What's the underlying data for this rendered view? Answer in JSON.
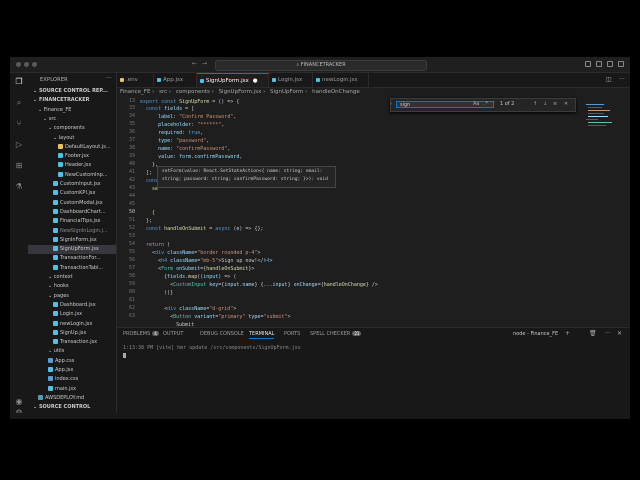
{
  "titlebar": {
    "search": "FINANCETRACKER"
  },
  "sidebar": {
    "title": "EXPLORER",
    "rows": [
      {
        "label": "SOURCE CONTROL REP...",
        "kind": "hdr",
        "indent": 1,
        "color": ""
      },
      {
        "label": "FINANCETRACKER",
        "kind": "hdr",
        "indent": 1,
        "color": ""
      },
      {
        "label": "Finance_FE",
        "kind": "folder",
        "indent": 2,
        "color": ""
      },
      {
        "label": "src",
        "kind": "folder",
        "indent": 3,
        "color": ""
      },
      {
        "label": "components",
        "kind": "folder",
        "indent": 4,
        "color": ""
      },
      {
        "label": "layout",
        "kind": "folder",
        "indent": 5,
        "color": ""
      },
      {
        "label": "DefaultLayout.js...",
        "kind": "file",
        "indent": 6,
        "color": "#e8c25b"
      },
      {
        "label": "Footer.jsx",
        "kind": "file",
        "indent": 6,
        "color": "#4fc1e9"
      },
      {
        "label": "Header.jsx",
        "kind": "file",
        "indent": 6,
        "color": "#4fc1e9"
      },
      {
        "label": "NewCustomInp...",
        "kind": "file",
        "indent": 6,
        "color": "#4fc1e9"
      },
      {
        "label": "CustomInput.jsx",
        "kind": "file",
        "indent": 5,
        "color": "#4fc1e9"
      },
      {
        "label": "CustomKPI.jsx",
        "kind": "file",
        "indent": 5,
        "color": "#4fc1e9"
      },
      {
        "label": "CustomModal.jsx",
        "kind": "file",
        "indent": 5,
        "color": "#4fc1e9"
      },
      {
        "label": "DashboardChart...",
        "kind": "file",
        "indent": 5,
        "color": "#4fc1e9"
      },
      {
        "label": "FinancialTips.jsx",
        "kind": "file",
        "indent": 5,
        "color": "#4fc1e9"
      },
      {
        "label": "NewSignInLogin.j...",
        "kind": "file",
        "indent": 5,
        "color": "#4fc1e9",
        "dim": true
      },
      {
        "label": "SignInForm.jsx",
        "kind": "file",
        "indent": 5,
        "color": "#4fc1e9"
      },
      {
        "label": "SignUpForm.jsx",
        "kind": "file",
        "indent": 5,
        "color": "#4fc1e9",
        "sel": true
      },
      {
        "label": "TransactionFor...",
        "kind": "file",
        "indent": 5,
        "color": "#4fc1e9"
      },
      {
        "label": "TransactionTabl...",
        "kind": "file",
        "indent": 5,
        "color": "#4fc1e9"
      },
      {
        "label": "context",
        "kind": "folder",
        "indent": 4,
        "color": ""
      },
      {
        "label": "hooks",
        "kind": "folder",
        "indent": 4,
        "color": ""
      },
      {
        "label": "pages",
        "kind": "folder",
        "indent": 4,
        "color": ""
      },
      {
        "label": "Dashboard.jsx",
        "kind": "file",
        "indent": 5,
        "color": "#4fc1e9"
      },
      {
        "label": "Login.jsx",
        "kind": "file",
        "indent": 5,
        "color": "#4fc1e9"
      },
      {
        "label": "newLogin.jsx",
        "kind": "file",
        "indent": 5,
        "color": "#4fc1e9"
      },
      {
        "label": "SignUp.jsx",
        "kind": "file",
        "indent": 5,
        "color": "#4fc1e9"
      },
      {
        "label": "Transaction.jsx",
        "kind": "file",
        "indent": 5,
        "color": "#4fc1e9"
      },
      {
        "label": "utils",
        "kind": "folder",
        "indent": 4,
        "color": ""
      },
      {
        "label": "App.css",
        "kind": "file",
        "indent": 4,
        "color": "#569cd6"
      },
      {
        "label": "App.jsx",
        "kind": "file",
        "indent": 4,
        "color": "#4fc1e9"
      },
      {
        "label": "index.css",
        "kind": "file",
        "indent": 4,
        "color": "#569cd6"
      },
      {
        "label": "main.jsx",
        "kind": "file",
        "indent": 4,
        "color": "#4fc1e9"
      },
      {
        "label": "AWSDEPLOY.md",
        "kind": "file",
        "indent": 2,
        "color": "#519aba"
      },
      {
        "label": "SOURCE CONTROL",
        "kind": "hdr",
        "indent": 1,
        "color": ""
      }
    ]
  },
  "tabs": [
    {
      "label": ".env",
      "color": "#e8c25b",
      "active": false
    },
    {
      "label": "App.jsx",
      "color": "#4fc1e9",
      "active": false
    },
    {
      "label": "SignUpForm.jsx",
      "color": "#4fc1e9",
      "active": true,
      "dot": "●"
    },
    {
      "label": "Login.jsx",
      "color": "#4fc1e9",
      "active": false
    },
    {
      "label": "newLogin.jsx",
      "color": "#4fc1e9",
      "active": false
    }
  ],
  "breadcrumbs": [
    "Finance_FE",
    "src",
    "components",
    "SignUpForm.jsx",
    "SignUpForm",
    "handleOnChange"
  ],
  "find": {
    "value": "sign",
    "count": "1 of 2"
  },
  "hover": {
    "line1": "setForm(value: React.SetStateAction<{ name: string; email:",
    "line2": "string; password: string; confirmPassword: string; }>): void"
  },
  "line_numbers": [
    "13",
    "",
    "",
    "",
    "",
    "",
    "",
    "",
    "",
    "",
    "",
    "",
    "",
    "",
    "",
    "",
    "",
    "",
    "",
    "",
    "",
    "",
    "",
    "",
    "",
    "",
    ""
  ],
  "panel": {
    "tabs": [
      {
        "label": "PROBLEMS",
        "badge": "4"
      },
      {
        "label": "OUTPUT",
        "badge": ""
      },
      {
        "label": "DEBUG CONSOLE",
        "badge": ""
      },
      {
        "label": "TERMINAL",
        "badge": "",
        "active": true
      },
      {
        "label": "PORTS",
        "badge": ""
      },
      {
        "label": "SPELL CHECKER",
        "badge": "21"
      }
    ],
    "terminal_label": "node - Finance_FE",
    "terminal_line": "1:13:38 PM [vite] hmr update /src/components/SignUpForm.jsx"
  }
}
